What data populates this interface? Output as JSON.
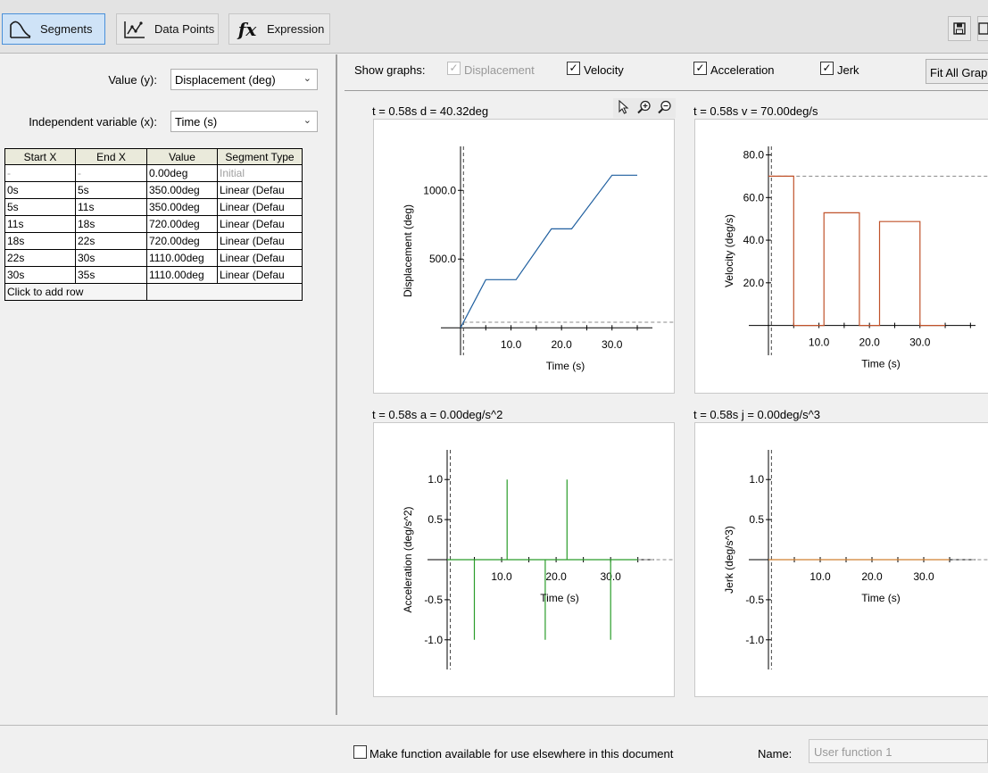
{
  "toolbar": {
    "tabs": [
      {
        "label": "Segments",
        "icon": "segments-curve-icon",
        "active": true
      },
      {
        "label": "Data Points",
        "icon": "data-points-icon",
        "active": false
      },
      {
        "label": "Expression",
        "icon": "fx-icon",
        "active": false
      }
    ],
    "fx_glyph": "fx",
    "right_icons": [
      "save-icon",
      "export-icon"
    ]
  },
  "form": {
    "value_label": "Value (y):",
    "value_selected": "Displacement (deg)",
    "indep_label": "Independent variable (x):",
    "indep_selected": "Time (s)"
  },
  "table": {
    "headers": [
      "Start X",
      "End X",
      "Value",
      "Segment Type"
    ],
    "rows": [
      [
        "-",
        "-",
        "0.00deg",
        "Initial"
      ],
      [
        "0s",
        "5s",
        "350.00deg",
        "Linear (Defau"
      ],
      [
        "5s",
        "11s",
        "350.00deg",
        "Linear (Defau"
      ],
      [
        "11s",
        "18s",
        "720.00deg",
        "Linear (Defau"
      ],
      [
        "18s",
        "22s",
        "720.00deg",
        "Linear (Defau"
      ],
      [
        "22s",
        "30s",
        "1110.00deg",
        "Linear (Defau"
      ],
      [
        "30s",
        "35s",
        "1110.00deg",
        "Linear (Defau"
      ]
    ],
    "add_row_label": "Click to add row"
  },
  "show_graphs": {
    "label": "Show graphs:",
    "items": [
      {
        "label": "Displacement",
        "checked": true,
        "disabled": true
      },
      {
        "label": "Velocity",
        "checked": true,
        "disabled": false
      },
      {
        "label": "Acceleration",
        "checked": true,
        "disabled": false
      },
      {
        "label": "Jerk",
        "checked": true,
        "disabled": false
      }
    ],
    "fit_button": "Fit All Grap",
    "check_glyph": "✓"
  },
  "graph_tools": [
    "pointer-icon",
    "zoom-in-icon",
    "zoom-out-icon"
  ],
  "readouts": {
    "displacement": "t = 0.58s  d = 40.32deg",
    "velocity": "t = 0.58s  v = 70.00deg/s",
    "acceleration": "t = 0.58s  a = 0.00deg/s^2",
    "jerk": "t = 0.58s  j = 0.00deg/s^3"
  },
  "chart_data": [
    {
      "type": "line",
      "name": "displacement",
      "xlabel": "Time (s)",
      "ylabel": "Displacement (deg)",
      "x_ticks": [
        "10.0",
        "20.0",
        "30.0"
      ],
      "y_ticks": [
        "500.0",
        "1000.0"
      ],
      "x_tick_values": [
        10,
        20,
        30
      ],
      "y_tick_values": [
        500,
        1000
      ],
      "xlim": [
        0,
        38
      ],
      "ylim": [
        -200,
        1320
      ],
      "cursor_x": 0.58,
      "reference_y": 40.32,
      "color": "#1f5f9f",
      "points": [
        [
          0,
          0
        ],
        [
          5,
          350
        ],
        [
          11,
          350
        ],
        [
          18,
          720
        ],
        [
          22,
          720
        ],
        [
          30,
          1110
        ],
        [
          35,
          1110
        ]
      ]
    },
    {
      "type": "line",
      "name": "velocity",
      "xlabel": "Time (s)",
      "ylabel": "Velocity (deg/s)",
      "x_ticks": [
        "10.0",
        "20.0",
        "30.0"
      ],
      "y_ticks": [
        "20.0",
        "40.0",
        "60.0",
        "80.0"
      ],
      "x_tick_values": [
        10,
        20,
        30
      ],
      "y_tick_values": [
        20,
        40,
        60,
        80
      ],
      "xlim": [
        0,
        41
      ],
      "ylim": [
        -14,
        84
      ],
      "cursor_x": 0.58,
      "reference_y": 70,
      "color": "#c0522a",
      "points": [
        [
          0,
          70
        ],
        [
          5,
          70
        ],
        [
          5,
          0
        ],
        [
          11,
          0
        ],
        [
          11,
          52.86
        ],
        [
          18,
          52.86
        ],
        [
          18,
          0
        ],
        [
          22,
          0
        ],
        [
          22,
          48.75
        ],
        [
          30,
          48.75
        ],
        [
          30,
          0
        ],
        [
          35,
          0
        ]
      ]
    },
    {
      "type": "line",
      "name": "acceleration",
      "xlabel": "Time (s)",
      "ylabel": "Acceleration (deg/s^2)",
      "x_ticks": [
        "10.0",
        "20.0",
        "30.0"
      ],
      "y_ticks": [
        "-1.0",
        "-0.5",
        "0.5",
        "1.0"
      ],
      "x_tick_values": [
        10,
        20,
        30
      ],
      "y_tick_values": [
        -1,
        -0.5,
        0.5,
        1
      ],
      "xlim": [
        0,
        38
      ],
      "ylim": [
        -1.37,
        1.37
      ],
      "cursor_x": 0.58,
      "reference_y": 0,
      "color": "#2a9d2a",
      "points": [
        [
          0,
          0
        ],
        [
          5,
          0
        ],
        [
          5,
          -1
        ],
        [
          5,
          0
        ],
        [
          11,
          0
        ],
        [
          11,
          1
        ],
        [
          11,
          0
        ],
        [
          18,
          0
        ],
        [
          18,
          -1
        ],
        [
          18,
          0
        ],
        [
          22,
          0
        ],
        [
          22,
          1
        ],
        [
          22,
          0
        ],
        [
          30,
          0
        ],
        [
          30,
          -1
        ],
        [
          30,
          0
        ],
        [
          35,
          0
        ]
      ]
    },
    {
      "type": "line",
      "name": "jerk",
      "xlabel": "Time (s)",
      "ylabel": "Jerk (deg/s^3)",
      "x_ticks": [
        "10.0",
        "20.0",
        "30.0"
      ],
      "y_ticks": [
        "-1.0",
        "-0.5",
        "0.5",
        "1.0"
      ],
      "x_tick_values": [
        10,
        20,
        30
      ],
      "y_tick_values": [
        -1,
        -0.5,
        0.5,
        1
      ],
      "xlim": [
        0,
        40
      ],
      "ylim": [
        -1.37,
        1.37
      ],
      "cursor_x": 0.58,
      "reference_y": 0,
      "color": "#d08030",
      "points": [
        [
          0,
          0
        ],
        [
          35,
          0
        ]
      ]
    }
  ],
  "bottom": {
    "make_available_label": "Make function available for use elsewhere in this document",
    "make_available_checked": false,
    "name_label": "Name:",
    "name_placeholder": "User function 1"
  }
}
